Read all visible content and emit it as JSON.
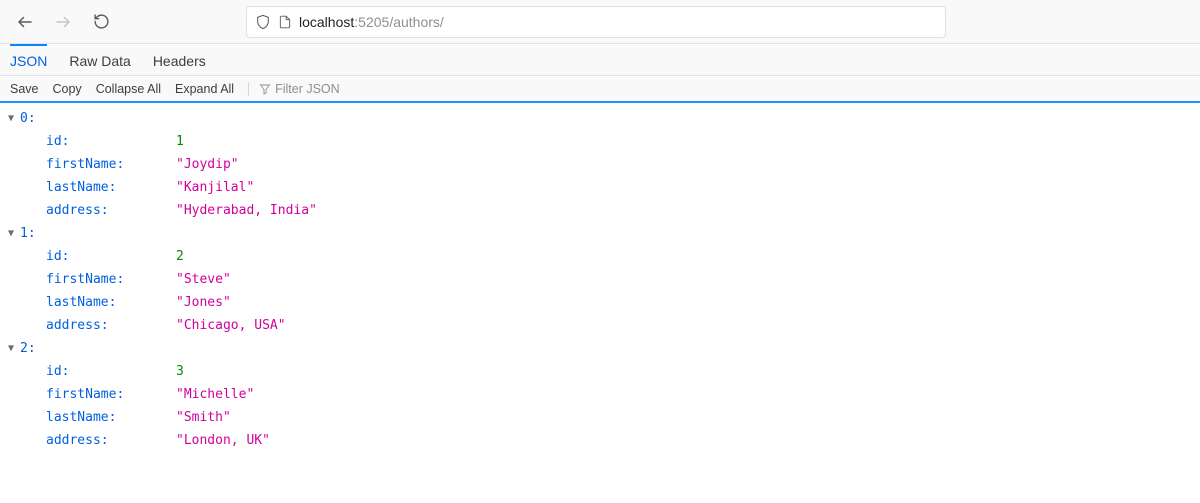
{
  "navbar": {
    "url_host": "localhost",
    "url_port": ":5205",
    "url_path": "/authors/"
  },
  "tabs": {
    "json": "JSON",
    "raw": "Raw Data",
    "headers": "Headers"
  },
  "toolbar": {
    "save": "Save",
    "copy": "Copy",
    "collapse": "Collapse All",
    "expand": "Expand All",
    "filter_placeholder": "Filter JSON"
  },
  "json": [
    {
      "id": 1,
      "firstName": "Joydip",
      "lastName": "Kanjilal",
      "address": "Hyderabad, India"
    },
    {
      "id": 2,
      "firstName": "Steve",
      "lastName": "Jones",
      "address": "Chicago, USA"
    },
    {
      "id": 3,
      "firstName": "Michelle",
      "lastName": "Smith",
      "address": "London, UK"
    }
  ],
  "keys": {
    "id": "id",
    "firstName": "firstName",
    "lastName": "lastName",
    "address": "address"
  }
}
